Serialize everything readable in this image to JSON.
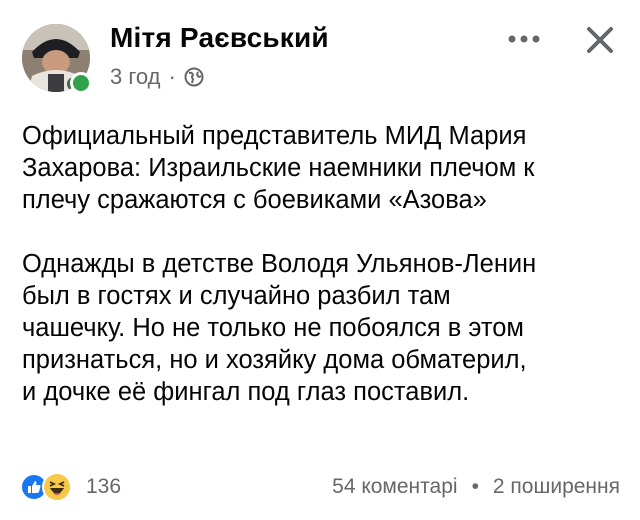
{
  "post": {
    "author_name": "Мітя Раєвський",
    "time": "3 год",
    "separator": "·",
    "privacy_icon": "globe-icon",
    "more_icon": "more-horizontal-icon",
    "close_icon": "close-icon",
    "online": true,
    "paragraphs": [
      "Официальный представитель МИД Мария\nЗахарова: Израильские наемники плечом к\nплечу сражаются с боевиками «Азова»",
      "Однажды в детстве Володя Ульянов-Ленин\nбыл в гостях и случайно разбил там\nчашечку. Но не только не побоялся в этом\nпризнаться, но и хозяйку дома обматерил,\nи дочке её фингал под глаз поставил."
    ]
  },
  "footer": {
    "reaction_icons": [
      "like-icon",
      "haha-icon"
    ],
    "reaction_count": "136",
    "comments": "54 коментарі",
    "dot": "•",
    "shares": "2 поширення"
  },
  "colors": {
    "like_blue": "#1877f2",
    "haha_yellow": "#f7c948",
    "online_green": "#31a24c",
    "meta_gray": "#65676b"
  }
}
